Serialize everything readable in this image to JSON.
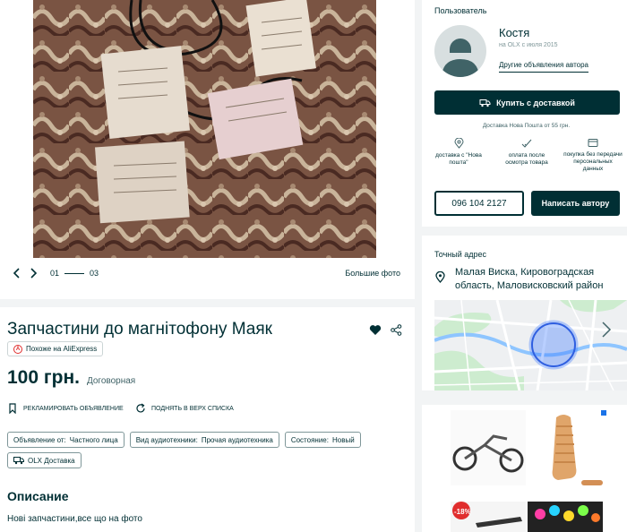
{
  "gallery": {
    "page_current": "01",
    "page_total": "03",
    "bigger_photos": "Большие фото"
  },
  "listing": {
    "title": "Запчастини до магнітофону Маяк",
    "aliexpress_badge": "Похоже на AliExpress",
    "price": "100 грн.",
    "negotiable": "Договорная",
    "promote": "РЕКЛАМИРОВАТЬ ОБЪЯВЛЕНИЕ",
    "bump": "ПОДНЯТЬ В ВЕРХ СПИСКА",
    "tags": [
      {
        "key": "Объявление от: ",
        "value": "Частного лица"
      },
      {
        "key": "Вид аудиотехники: ",
        "value": "Прочая аудиотехника"
      },
      {
        "key": "Состояние: ",
        "value": "Новый"
      }
    ],
    "olx_delivery": "OLX Доставка",
    "description_heading": "Описание",
    "description": "Нові запчастини,все що на фото"
  },
  "seller": {
    "heading": "Пользователь",
    "name": "Костя",
    "since": "на OLX с июля 2015",
    "other_ads": "Другие объявления автора",
    "buy_delivery": "Купить с доставкой",
    "delivery_note": "Доставка Нова Пошта от 55 грн.",
    "features": [
      {
        "icon": "location-pin-icon",
        "text": "доставка с \"Нова пошта\""
      },
      {
        "icon": "checkmark-icon",
        "text": "оплата после осмотра товара"
      },
      {
        "icon": "card-icon",
        "text": "покупка без передачи персональных данных"
      }
    ],
    "phone": "096 104 2127",
    "write_author": "Написать автору"
  },
  "address": {
    "heading": "Точный адрес",
    "location": "Малая Виска, Кировоградская область, Маловисковский район"
  },
  "colors": {
    "dark": "#002f34",
    "map_accent": "#3a77ff"
  }
}
